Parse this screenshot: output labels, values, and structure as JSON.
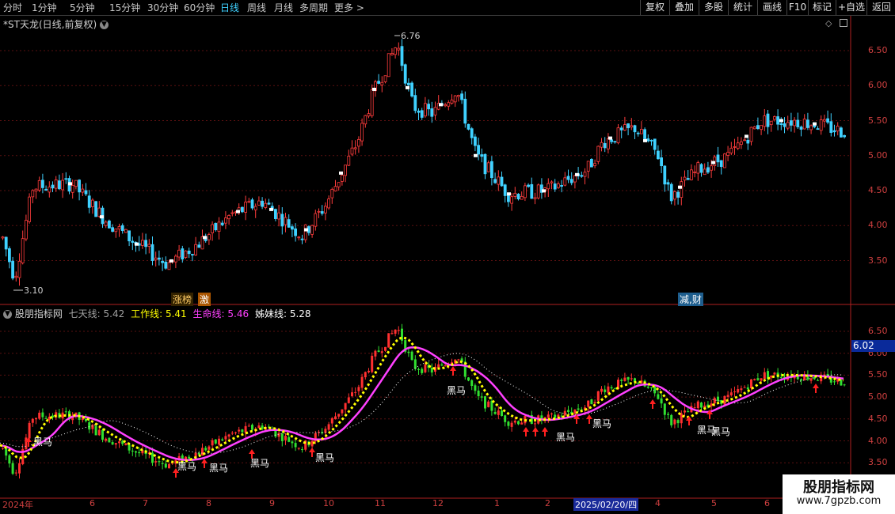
{
  "toolbar": {
    "periods": [
      "分时",
      "1分钟",
      "5分钟",
      "15分钟",
      "30分钟",
      "60分钟",
      "日线",
      "周线",
      "月线",
      "多周期",
      "更多 >"
    ],
    "active_period": "日线",
    "buttons": [
      "复权",
      "叠加",
      "多股",
      "统计",
      "画线",
      "F10",
      "标记",
      "+自选",
      "返回"
    ]
  },
  "main": {
    "title": "*ST天龙(日线,前复权)",
    "high_label": "6.76",
    "low_label": "3.10",
    "badges": {
      "zhangbang": "涨榜",
      "ji": "激",
      "jiancai": "减,财"
    },
    "axis_ticks": [
      "6.50",
      "6.00",
      "5.50",
      "5.00",
      "4.50",
      "4.00",
      "3.50"
    ]
  },
  "indicator": {
    "name": "股朋指标网",
    "lines": [
      {
        "label": "七天线:",
        "value": "5.42",
        "color": "#a0a0a0"
      },
      {
        "label": "工作线:",
        "value": "5.41",
        "color": "#ffff00"
      },
      {
        "label": "生命线:",
        "value": "5.46",
        "color": "#ff40ff"
      },
      {
        "label": "姊妹线:",
        "value": "5.28",
        "color": "#ffffff"
      }
    ],
    "axis_ticks": [
      "6.50",
      "6.00",
      "5.50",
      "5.00",
      "4.50",
      "4.00",
      "3.50"
    ],
    "current_price": "6.02",
    "signal_label": "黑马"
  },
  "date_axis": {
    "labels": [
      "2024年",
      "6",
      "7",
      "8",
      "9",
      "10",
      "11",
      "12",
      "1",
      "2",
      "2025/02/20/四",
      "4",
      "5",
      "6"
    ]
  },
  "watermark": {
    "title": "股朋指标网",
    "url": "www.7gpzb.com"
  },
  "colors": {
    "up": "#ff3c3c",
    "down": "#3fd1ff",
    "accent": "#3fd1ff",
    "work_line": "#ffff00",
    "life_line": "#ff40ff"
  }
}
